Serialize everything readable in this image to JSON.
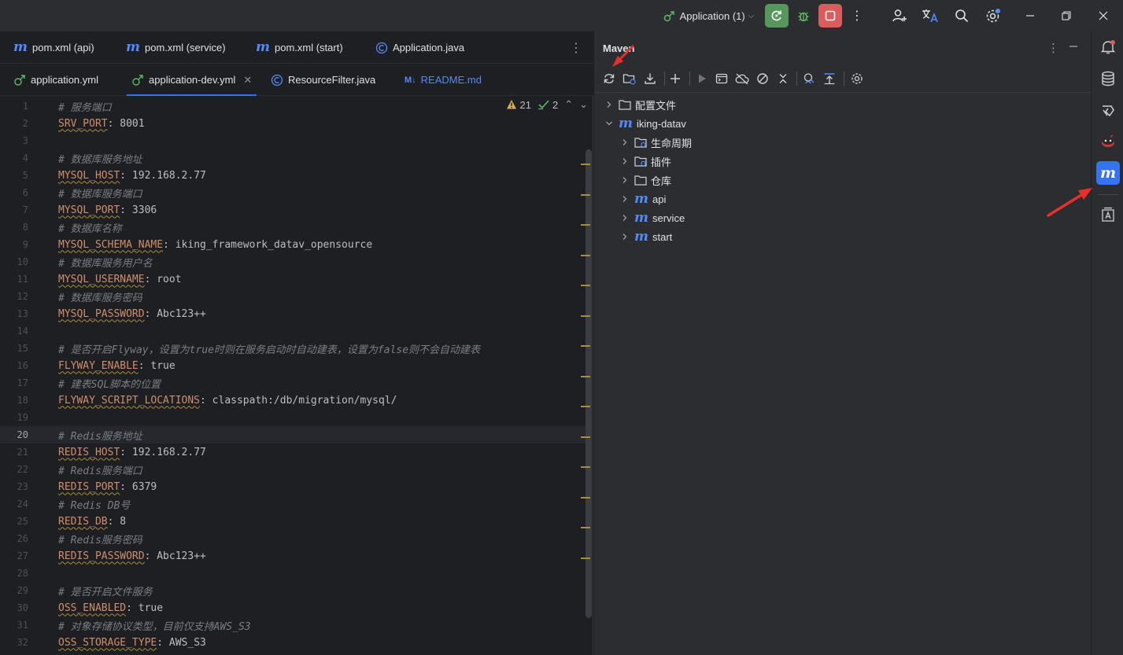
{
  "titlebar": {
    "run_config": "Application (1)",
    "icons": [
      "run-config-icon",
      "rerun-icon",
      "debug-icon",
      "stop-icon",
      "more-icon",
      "add-user-icon",
      "translate-icon",
      "search-icon",
      "settings-icon",
      "minimize-icon",
      "restore-icon",
      "close-icon"
    ]
  },
  "editor": {
    "tabs_row1": [
      {
        "label": "pom.xml (api)",
        "icon": "maven-icon"
      },
      {
        "label": "pom.xml (service)",
        "icon": "maven-icon"
      },
      {
        "label": "pom.xml (start)",
        "icon": "maven-icon"
      },
      {
        "label": "Application.java",
        "icon": "java-class-icon"
      }
    ],
    "tabs_row2": [
      {
        "label": "application.yml",
        "icon": "yaml-icon"
      },
      {
        "label": "application-dev.yml",
        "icon": "yaml-icon",
        "active": true
      },
      {
        "label": "ResourceFilter.java",
        "icon": "class-icon"
      },
      {
        "label": "README.md",
        "icon": "markdown-icon"
      }
    ],
    "inspections": {
      "warnings": "21",
      "ok": "2"
    },
    "current_line": 20,
    "lines": [
      {
        "n": "1",
        "comment": "# 服务端口"
      },
      {
        "n": "2",
        "key": "SRV_PORT",
        "value": ": 8001"
      },
      {
        "n": "3"
      },
      {
        "n": "4",
        "comment": "# 数据库服务地址"
      },
      {
        "n": "5",
        "key": "MYSQL_HOST",
        "value": ": 192.168.2.77"
      },
      {
        "n": "6",
        "comment": "# 数据库服务端口"
      },
      {
        "n": "7",
        "key": "MYSQL_PORT",
        "value": ": 3306"
      },
      {
        "n": "8",
        "comment": "# 数据库名称"
      },
      {
        "n": "9",
        "key": "MYSQL_SCHEMA_NAME",
        "value": ": iking_framework_datav_opensource"
      },
      {
        "n": "10",
        "comment": "# 数据库服务用户名"
      },
      {
        "n": "11",
        "key": "MYSQL_USERNAME",
        "value": ": root"
      },
      {
        "n": "12",
        "comment": "# 数据库服务密码"
      },
      {
        "n": "13",
        "key": "MYSQL_PASSWORD",
        "value": ": Abc123++"
      },
      {
        "n": "14"
      },
      {
        "n": "15",
        "comment": "# 是否开启Flyway，设置为true时则在服务启动时自动建表，设置为false则不会自动建表"
      },
      {
        "n": "16",
        "key": "FLYWAY_ENABLE",
        "value": ": true"
      },
      {
        "n": "17",
        "comment": "# 建表SQL脚本的位置"
      },
      {
        "n": "18",
        "key": "FLYWAY_SCRIPT_LOCATIONS",
        "value": ": classpath:/db/migration/mysql/"
      },
      {
        "n": "19"
      },
      {
        "n": "20",
        "comment": "# Redis服务地址"
      },
      {
        "n": "21",
        "key": "REDIS_HOST",
        "value": ": 192.168.2.77"
      },
      {
        "n": "22",
        "comment": "# Redis服务端口"
      },
      {
        "n": "23",
        "key": "REDIS_PORT",
        "value": ": 6379"
      },
      {
        "n": "24",
        "comment": "# Redis DB号"
      },
      {
        "n": "25",
        "key": "REDIS_DB",
        "value": ": 8"
      },
      {
        "n": "26",
        "comment": "# Redis服务密码"
      },
      {
        "n": "27",
        "key": "REDIS_PASSWORD",
        "value": ": Abc123++"
      },
      {
        "n": "28"
      },
      {
        "n": "29",
        "comment": "# 是否开启文件服务"
      },
      {
        "n": "30",
        "key": "OSS_ENABLED",
        "value": ": true"
      },
      {
        "n": "31",
        "comment": "# 对象存储协议类型，目前仅支持AWS_S3"
      },
      {
        "n": "32",
        "key": "OSS_STORAGE_TYPE",
        "value": ": AWS_S3"
      }
    ]
  },
  "maven": {
    "title": "Maven",
    "toolbar_icons": [
      "reload-icon",
      "add-folder-icon",
      "download-icon",
      "add-icon",
      "run-icon",
      "execute-goal-icon",
      "offline-icon",
      "skip-tests-icon",
      "collapse-icon",
      "show-dependencies-icon",
      "collapse-all-icon",
      "settings-icon"
    ],
    "tree": [
      {
        "label": "配置文件",
        "icon": "folder-icon",
        "level": 0,
        "expanded": false
      },
      {
        "label": "iking-datav",
        "icon": "maven-icon",
        "level": 0,
        "expanded": true
      },
      {
        "label": "生命周期",
        "icon": "folder-gear-icon",
        "level": 1,
        "expanded": false
      },
      {
        "label": "插件",
        "icon": "folder-gear-icon",
        "level": 1,
        "expanded": false
      },
      {
        "label": "仓库",
        "icon": "folder-icon",
        "level": 1,
        "expanded": false
      },
      {
        "label": "api",
        "icon": "maven-icon",
        "level": 1,
        "expanded": false
      },
      {
        "label": "service",
        "icon": "maven-icon",
        "level": 1,
        "expanded": false
      },
      {
        "label": "start",
        "icon": "maven-icon",
        "level": 1,
        "expanded": false
      }
    ]
  },
  "right_strip": {
    "icons": [
      "notifications-icon",
      "database-icon",
      "ai-assistant-icon",
      "plugin-icon",
      "maven-tool-icon",
      "text-tool-icon"
    ],
    "active": "maven-tool-icon"
  },
  "colors": {
    "accent": "#3574f0",
    "rerun_green": "#57965c",
    "stop_red": "#db5c5c",
    "annotation_red": "#e8302a"
  }
}
